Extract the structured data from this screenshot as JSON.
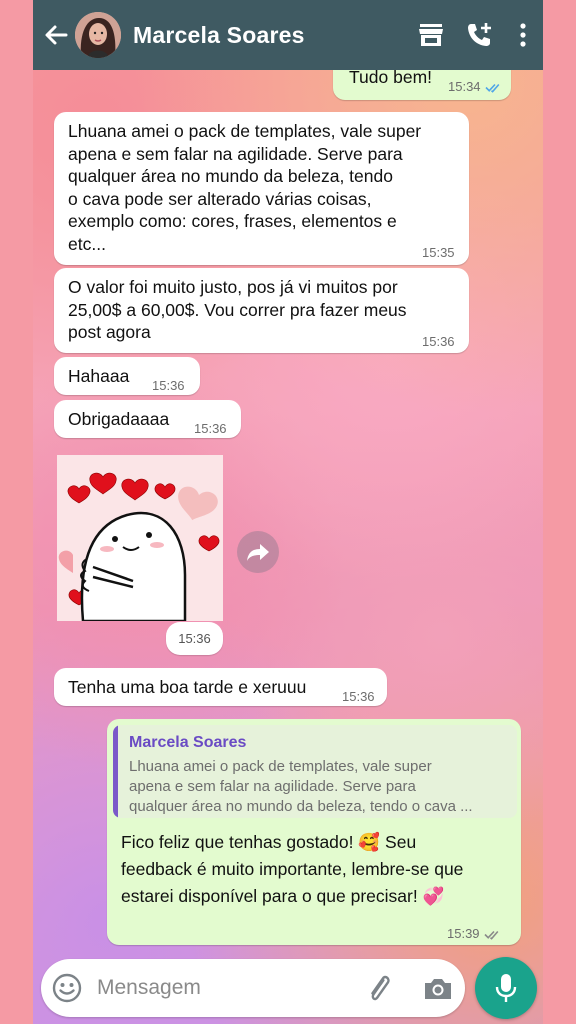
{
  "header": {
    "contact_name": "Marcela Soares",
    "back_icon": "arrow-left",
    "store_icon": "storefront",
    "call_icon": "phone-add",
    "menu_icon": "more-vert",
    "bg_color": "#3f5a62"
  },
  "messages": [
    {
      "type": "out",
      "text": "Tudo bem!",
      "time": "15:34",
      "status": "read"
    },
    {
      "type": "in",
      "text": "Lhuana amei o pack de templates, vale super\napena e sem falar na agilidade. Serve para\nqualquer área no mundo da beleza, tendo\no cava pode ser alterado várias coisas,\nexemplo como: cores, frases, elementos e\netc...",
      "time": "15:35"
    },
    {
      "type": "in",
      "text": "O valor foi muito justo, pos já vi muitos por\n25,00$ a 60,00$. Vou correr pra fazer meus\npost agora",
      "time": "15:36"
    },
    {
      "type": "in",
      "text": "Hahaaa",
      "time": "15:36"
    },
    {
      "type": "in",
      "text": "Obrigadaaaa",
      "time": "15:36"
    },
    {
      "type": "sticker",
      "time": "15:36"
    },
    {
      "type": "in",
      "text": "Tenha uma boa tarde e xeruuu",
      "time": "15:36"
    },
    {
      "type": "out",
      "quote_author": "Marcela Soares",
      "quote_text": "Lhuana amei o pack de templates, vale super\napena e sem falar na agilidade. Serve para\nqualquer área no mundo da beleza, tendo o cava ...",
      "text_line1_a": "Fico feliz que tenhas gostado! ",
      "emoji1": "🥰",
      "text_line1_b": " Seu",
      "text_line2": "feedback é muito importante, lembre-se que",
      "text_line3": "estarei disponível para o que precisar! ",
      "emoji2": "💞",
      "time": "15:39",
      "status": "delivered"
    }
  ],
  "composer": {
    "placeholder": "Mensagem",
    "emoji_icon": "emoji-face",
    "attach_icon": "paperclip",
    "camera_icon": "camera",
    "mic_icon": "microphone"
  },
  "colors": {
    "incoming_bubble": "#ffffff",
    "outgoing_bubble": "#e3fbcf",
    "read_ticks": "#4fa6e8",
    "mic_button": "#1aa38c",
    "quote_bar": "#7b59c9"
  }
}
